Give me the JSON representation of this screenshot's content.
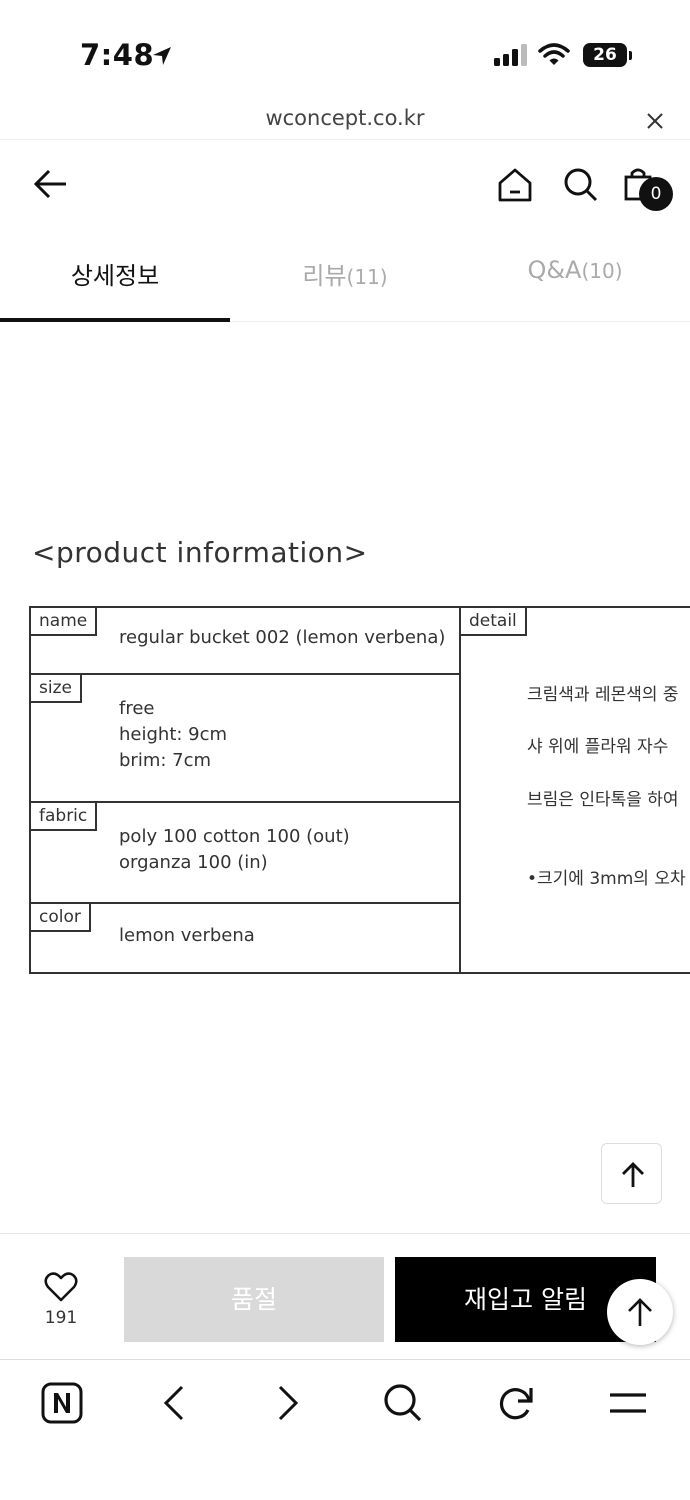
{
  "status_bar": {
    "time": "7:48",
    "battery": "26"
  },
  "browser": {
    "url": "wconcept.co.kr"
  },
  "header": {
    "cart_count": "0"
  },
  "tabs": [
    {
      "label": "상세정보",
      "count": "",
      "active": true
    },
    {
      "label": "리뷰",
      "count": "(11)",
      "active": false
    },
    {
      "label": "Q&A",
      "count": "(10)",
      "active": false
    }
  ],
  "product_info": {
    "title": "<product information>",
    "rows": [
      {
        "tag": "name",
        "lines": [
          "regular bucket 002 (lemon verbena)"
        ]
      },
      {
        "tag": "size",
        "lines": [
          "free",
          "height: 9cm",
          "brim: 7cm"
        ]
      },
      {
        "tag": "fabric",
        "lines": [
          "poly 100 cotton 100 (out)",
          "organza 100 (in)"
        ]
      },
      {
        "tag": "color",
        "lines": [
          "lemon verbena"
        ]
      }
    ],
    "detail_tag": "detail",
    "detail_lines": [
      "크림색과 레몬색의 중",
      "샤 위에 플라워 자수",
      "브림은 인타톡을 하여",
      "•크기에 3mm의 오차"
    ]
  },
  "purchase_bar": {
    "like_count": "191",
    "soldout_label": "품절",
    "restock_label": "재입고 알림"
  },
  "icons": [
    "location-arrow-icon",
    "signal-icon",
    "wifi-icon",
    "close-icon",
    "back-arrow-icon",
    "home-icon",
    "search-icon",
    "shopping-bag-icon",
    "arrow-up-icon",
    "heart-icon",
    "naver-icon",
    "chevron-left-icon",
    "chevron-right-icon",
    "refresh-icon",
    "menu-icon"
  ]
}
